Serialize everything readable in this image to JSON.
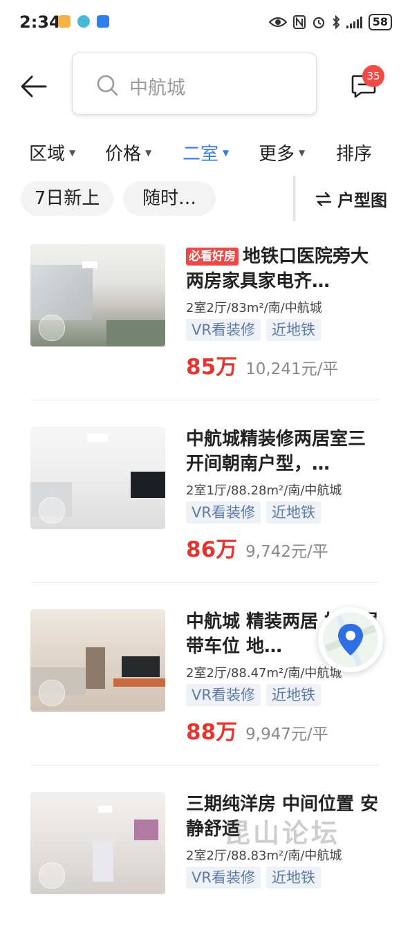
{
  "status_bar": {
    "time": "2:34",
    "battery": "58"
  },
  "header": {
    "search_text": "中航城",
    "message_badge": "35"
  },
  "filters": [
    {
      "label": "区域",
      "active": false
    },
    {
      "label": "价格",
      "active": false
    },
    {
      "label": "二室",
      "active": true
    },
    {
      "label": "更多",
      "active": false
    },
    {
      "label": "排序",
      "active": false
    }
  ],
  "quick_tags": [
    "7日新上",
    "随时…"
  ],
  "layout_toggle": {
    "label": "户型图"
  },
  "listings": [
    {
      "badge": "必看好房",
      "title": "地铁口医院旁大两房家具家电齐…",
      "specs": "2室2厅/83m²/南/中航城",
      "tags": [
        "VR看装修",
        "近地铁"
      ],
      "price_total": "85万",
      "price_unit": "10,241元/平"
    },
    {
      "badge": "",
      "title": "中航城精装修两居室三开间朝南户型，…",
      "specs": "2室1厅/88.28m²/南/中航城",
      "tags": [
        "VR看装修",
        "近地铁"
      ],
      "price_total": "86万",
      "price_unit": "9,742元/平"
    },
    {
      "badge": "",
      "title": "中航城 精装两居 好楼层 带车位 地…",
      "specs": "2室2厅/88.47m²/南/中航城",
      "tags": [
        "VR看装修",
        "近地铁"
      ],
      "price_total": "88万",
      "price_unit": "9,947元/平"
    },
    {
      "badge": "",
      "title": "三期纯洋房 中间位置 安静舒适",
      "specs": "2室2厅/88.83m²/南/中航城",
      "tags": [
        "VR看装修",
        "近地铁"
      ],
      "price_total": "",
      "price_unit": ""
    }
  ],
  "watermark": "昆山论坛",
  "colors": {
    "accent": "#3a78e7",
    "price": "#e5352f",
    "badge": "#f04b47"
  }
}
